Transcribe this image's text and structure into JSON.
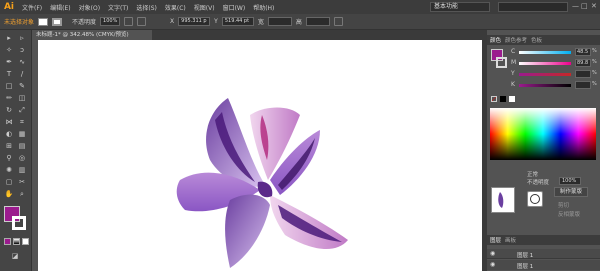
{
  "app": {
    "logo": "Ai"
  },
  "menu": [
    "文件(F)",
    "编辑(E)",
    "对象(O)",
    "文字(T)",
    "选择(S)",
    "效果(C)",
    "视图(V)",
    "窗口(W)",
    "帮助(H)"
  ],
  "workspace": "基本功能",
  "window_controls": [
    "—",
    "□",
    "✕"
  ],
  "controlbar": {
    "selection_label": "未选择对象",
    "opacity_label": "不透明度",
    "opacity_value": "100%",
    "x_label": "X",
    "x_value": "995.311 p",
    "y_label": "Y",
    "y_value": "519.44 pt",
    "w_label": "宽",
    "h_label": "高"
  },
  "document": {
    "tab_title": "未标题-1* @ 342.48% (CMYK/预览)"
  },
  "panels": {
    "color": {
      "tabs": [
        "颜色",
        "颜色参考",
        "色板"
      ],
      "channels": [
        {
          "label": "C",
          "value": "48.5",
          "unit": "%"
        },
        {
          "label": "M",
          "value": "89.8",
          "unit": "%"
        },
        {
          "label": "Y",
          "value": "",
          "unit": "%"
        },
        {
          "label": "K",
          "value": "",
          "unit": "%"
        }
      ]
    },
    "transparency": {
      "mode": "正常",
      "opacity_label": "不透明度",
      "opacity_value": "100%",
      "make_mask_button": "制作蒙版",
      "clip_label": "剪切",
      "invert_label": "反相蒙版"
    },
    "layers": {
      "tabs": [
        "图层",
        "画板"
      ],
      "items": [
        "图层 1",
        "图层 1"
      ]
    }
  },
  "colors": {
    "fill": "#9b1b8e",
    "accent": "#f0a030",
    "petal_dark": "#4a1a7a",
    "petal_light": "#c9a8e0"
  }
}
